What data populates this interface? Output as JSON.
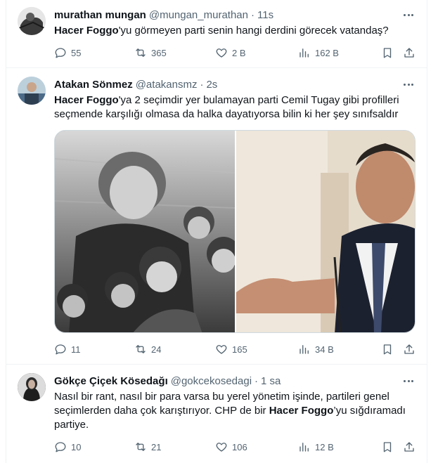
{
  "tweets": [
    {
      "name": "murathan mungan",
      "handle": "@mungan_murathan",
      "time": "11s",
      "text_bold": "Hacer Foggo",
      "text_rest": "'yu görmeyen parti senin hangi derdini görecek  vatandaş?",
      "stats": {
        "replies": "55",
        "retweets": "365",
        "likes": "2 B",
        "views": "162 B"
      }
    },
    {
      "name": "Atakan Sönmez",
      "handle": "@atakansmz",
      "time": "2s",
      "text_bold": "Hacer Foggo",
      "text_rest": "'ya 2 seçimdir yer bulamayan parti Cemil Tugay gibi profilleri seçmende karşılığı olmasa da halka dayatıyorsa bilin ki her şey sınıfsaldır",
      "stats": {
        "replies": "11",
        "retweets": "24",
        "likes": "165",
        "views": "34 B"
      }
    },
    {
      "name": "Gökçe Çiçek Kösedağı",
      "handle": "@gokcekosedagi",
      "time": "1 sa",
      "text_pre": "Nasıl bir rant, nasıl bir para varsa bu yerel yönetim işinde, partileri genel seçimlerden daha çok karıştırıyor. CHP de bir ",
      "text_bold": "Hacer Foggo",
      "text_rest": "’yu sığdıramadı partiye.",
      "stats": {
        "replies": "10",
        "retweets": "21",
        "likes": "106",
        "views": "12 B"
      }
    }
  ],
  "icons": {
    "reply": "reply-icon",
    "retweet": "retweet-icon",
    "like": "like-icon",
    "views": "views-icon",
    "bookmark": "bookmark-icon",
    "share": "share-icon",
    "more": "more-icon"
  },
  "colors": {
    "text": "#0f1419",
    "muted": "#536471",
    "border": "#eff3f4"
  }
}
